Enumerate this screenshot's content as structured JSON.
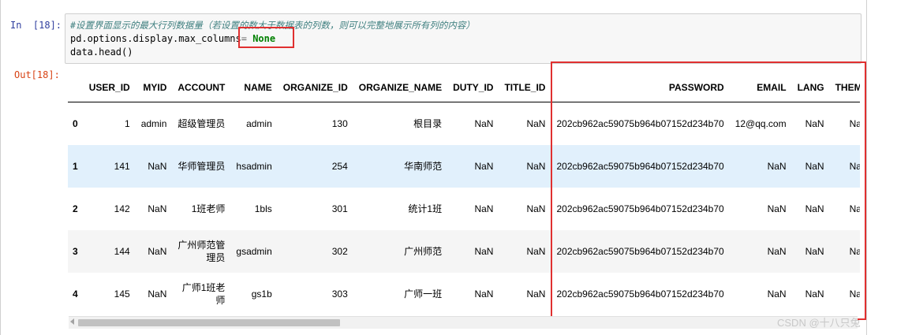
{
  "cell": {
    "in_prompt": "In  [18]:",
    "out_prompt": "Out[18]:",
    "code": {
      "comment": "#设置界面显示的最大行列数据量（若设置的数大于数据表的列数，则可以完整地展示所有列的内容）",
      "line2_prefix": "pd.options.display.max_columns",
      "line2_eq": "= ",
      "line2_value": "None",
      "line3": "data.head()"
    }
  },
  "dataframe": {
    "columns": [
      "USER_ID",
      "MYID",
      "ACCOUNT",
      "NAME",
      "ORGANIZE_ID",
      "ORGANIZE_NAME",
      "DUTY_ID",
      "TITLE_ID",
      "PASSWORD",
      "EMAIL",
      "LANG",
      "THEME"
    ],
    "rows": [
      {
        "index": "0",
        "cells": [
          "1",
          "admin",
          "超级管理员",
          "admin",
          "130",
          "根目录",
          "NaN",
          "NaN",
          "202cb962ac59075b964b07152d234b70",
          "12@qq.com",
          "NaN",
          "NaN"
        ]
      },
      {
        "index": "1",
        "cells": [
          "141",
          "NaN",
          "华师管理员",
          "hsadmin",
          "254",
          "华南师范",
          "NaN",
          "NaN",
          "202cb962ac59075b964b07152d234b70",
          "NaN",
          "NaN",
          "NaN"
        ]
      },
      {
        "index": "2",
        "cells": [
          "142",
          "NaN",
          "1班老师",
          "1bls",
          "301",
          "统计1班",
          "NaN",
          "NaN",
          "202cb962ac59075b964b07152d234b70",
          "NaN",
          "NaN",
          "NaN"
        ]
      },
      {
        "index": "3",
        "cells": [
          "144",
          "NaN",
          "广州师范管理员",
          "gsadmin",
          "302",
          "广州师范",
          "NaN",
          "NaN",
          "202cb962ac59075b964b07152d234b70",
          "NaN",
          "NaN",
          "NaN"
        ]
      },
      {
        "index": "4",
        "cells": [
          "145",
          "NaN",
          "广师1班老师",
          "gs1b",
          "303",
          "广师一班",
          "NaN",
          "NaN",
          "202cb962ac59075b964b07152d234b70",
          "NaN",
          "NaN",
          "NaN"
        ]
      }
    ],
    "hovered_row": 1
  },
  "watermark": "CSDN @十八只兔",
  "colors": {
    "annotation_red": "#e03030",
    "hover_row": "#e1f0fc",
    "in_prompt": "#303f9f",
    "out_prompt": "#d84315",
    "code_keyword": "#008000",
    "comment": "#408080"
  }
}
